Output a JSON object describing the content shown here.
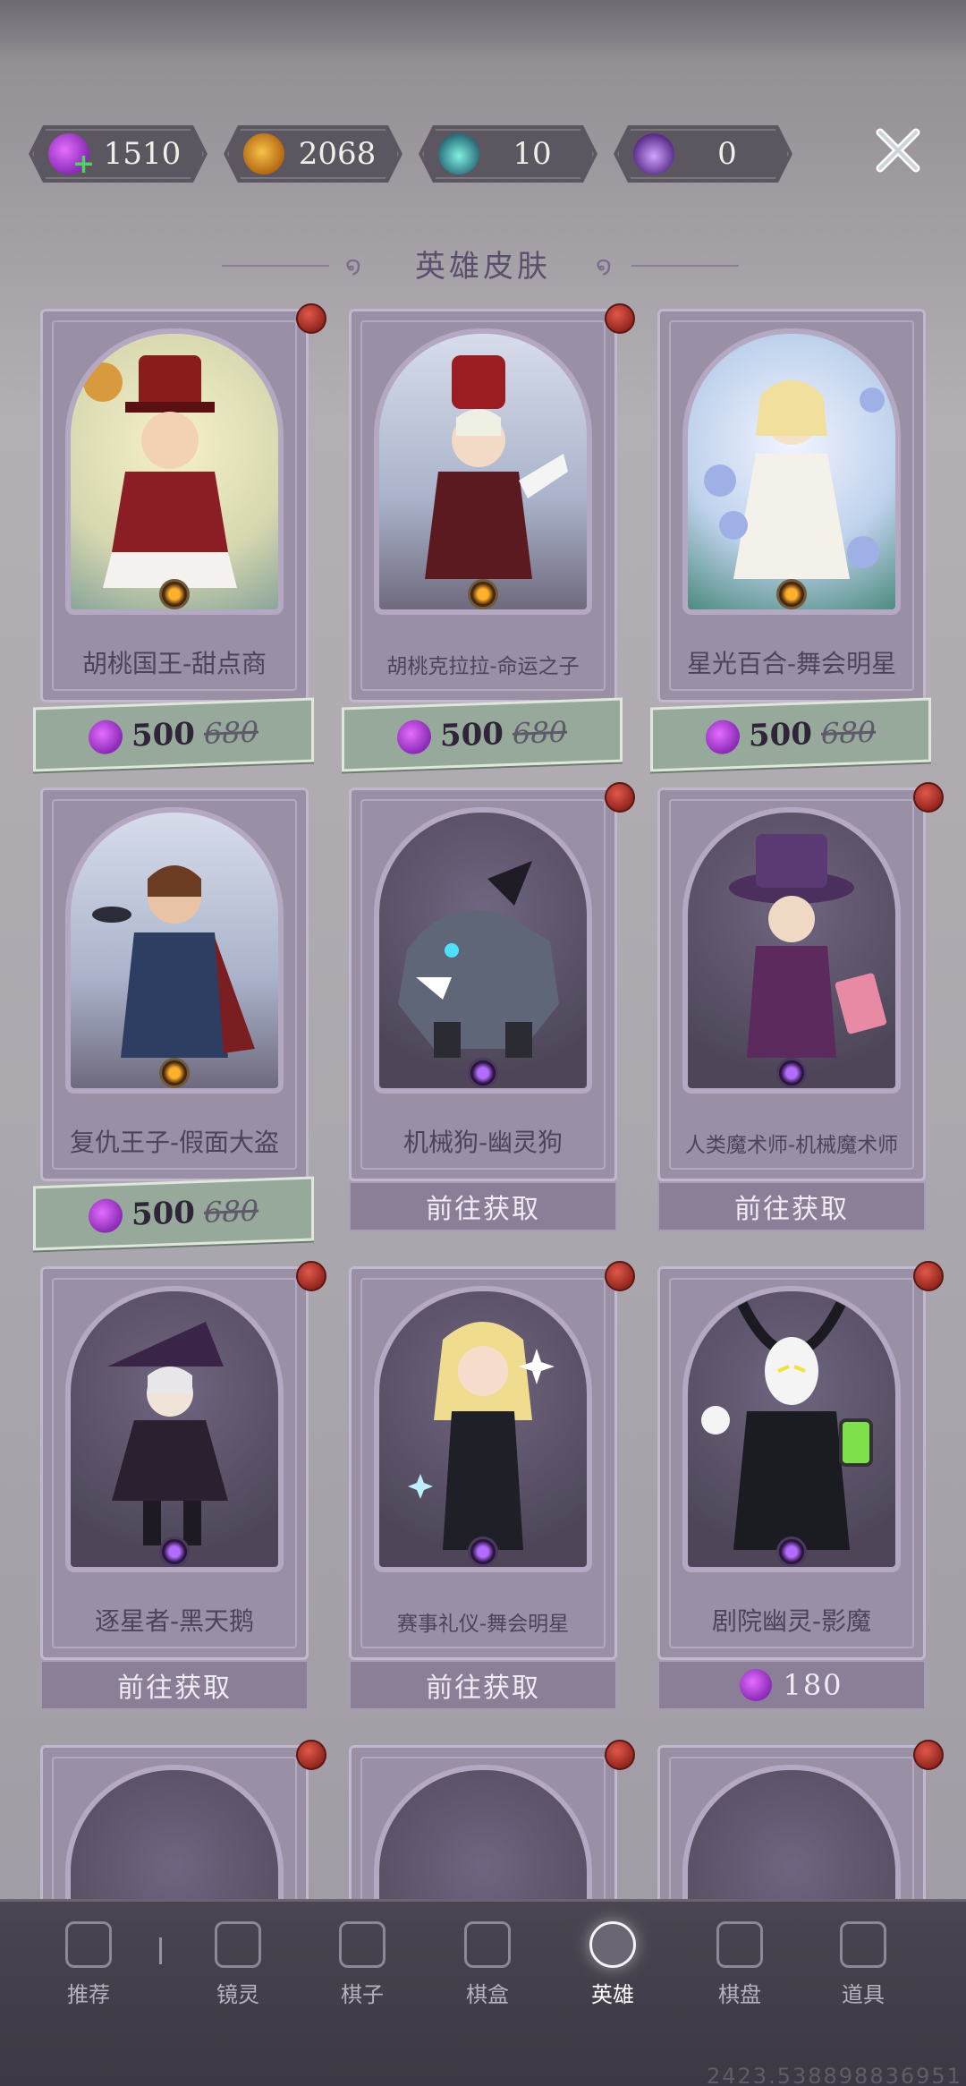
{
  "currencies": [
    {
      "name": "candy",
      "icon": "candy-plus-icon",
      "value": "1510"
    },
    {
      "name": "pumpkin",
      "icon": "pumpkin-icon",
      "value": "2068"
    },
    {
      "name": "teal-potion",
      "icon": "teal-potion-icon",
      "value": "10"
    },
    {
      "name": "purple-potion",
      "icon": "purple-potion-icon",
      "value": "0"
    }
  ],
  "section_title": "英雄皮肤",
  "skins": [
    {
      "name": "胡桃国王-甜点商",
      "price": "500",
      "old_price": "680",
      "action": null
    },
    {
      "name": "胡桃克拉拉-命运之子",
      "price": "500",
      "old_price": "680",
      "action": null
    },
    {
      "name": "星光百合-舞会明星",
      "price": "500",
      "old_price": "680",
      "action": null
    },
    {
      "name": "复仇王子-假面大盗",
      "price": "500",
      "old_price": "680",
      "action": null
    },
    {
      "name": "机械狗-幽灵狗",
      "action": "前往获取"
    },
    {
      "name": "人类魔术师-机械魔术师",
      "action": "前往获取"
    },
    {
      "name": "逐星者-黑天鹅",
      "action": "前往获取"
    },
    {
      "name": "赛事礼仪-舞会明星",
      "action": "前往获取"
    },
    {
      "name": "剧院幽灵-影魔",
      "price": "180",
      "action": null
    }
  ],
  "nav": [
    {
      "label": "推荐",
      "icon": "recommend-icon"
    },
    {
      "label": "镜灵",
      "icon": "mirror-spirit-icon"
    },
    {
      "label": "棋子",
      "icon": "chess-piece-icon"
    },
    {
      "label": "棋盒",
      "icon": "chess-box-icon"
    },
    {
      "label": "英雄",
      "icon": "hero-icon",
      "active": true
    },
    {
      "label": "棋盘",
      "icon": "chessboard-icon"
    },
    {
      "label": "道具",
      "icon": "props-icon"
    }
  ],
  "watermark": "2423.538898836951"
}
